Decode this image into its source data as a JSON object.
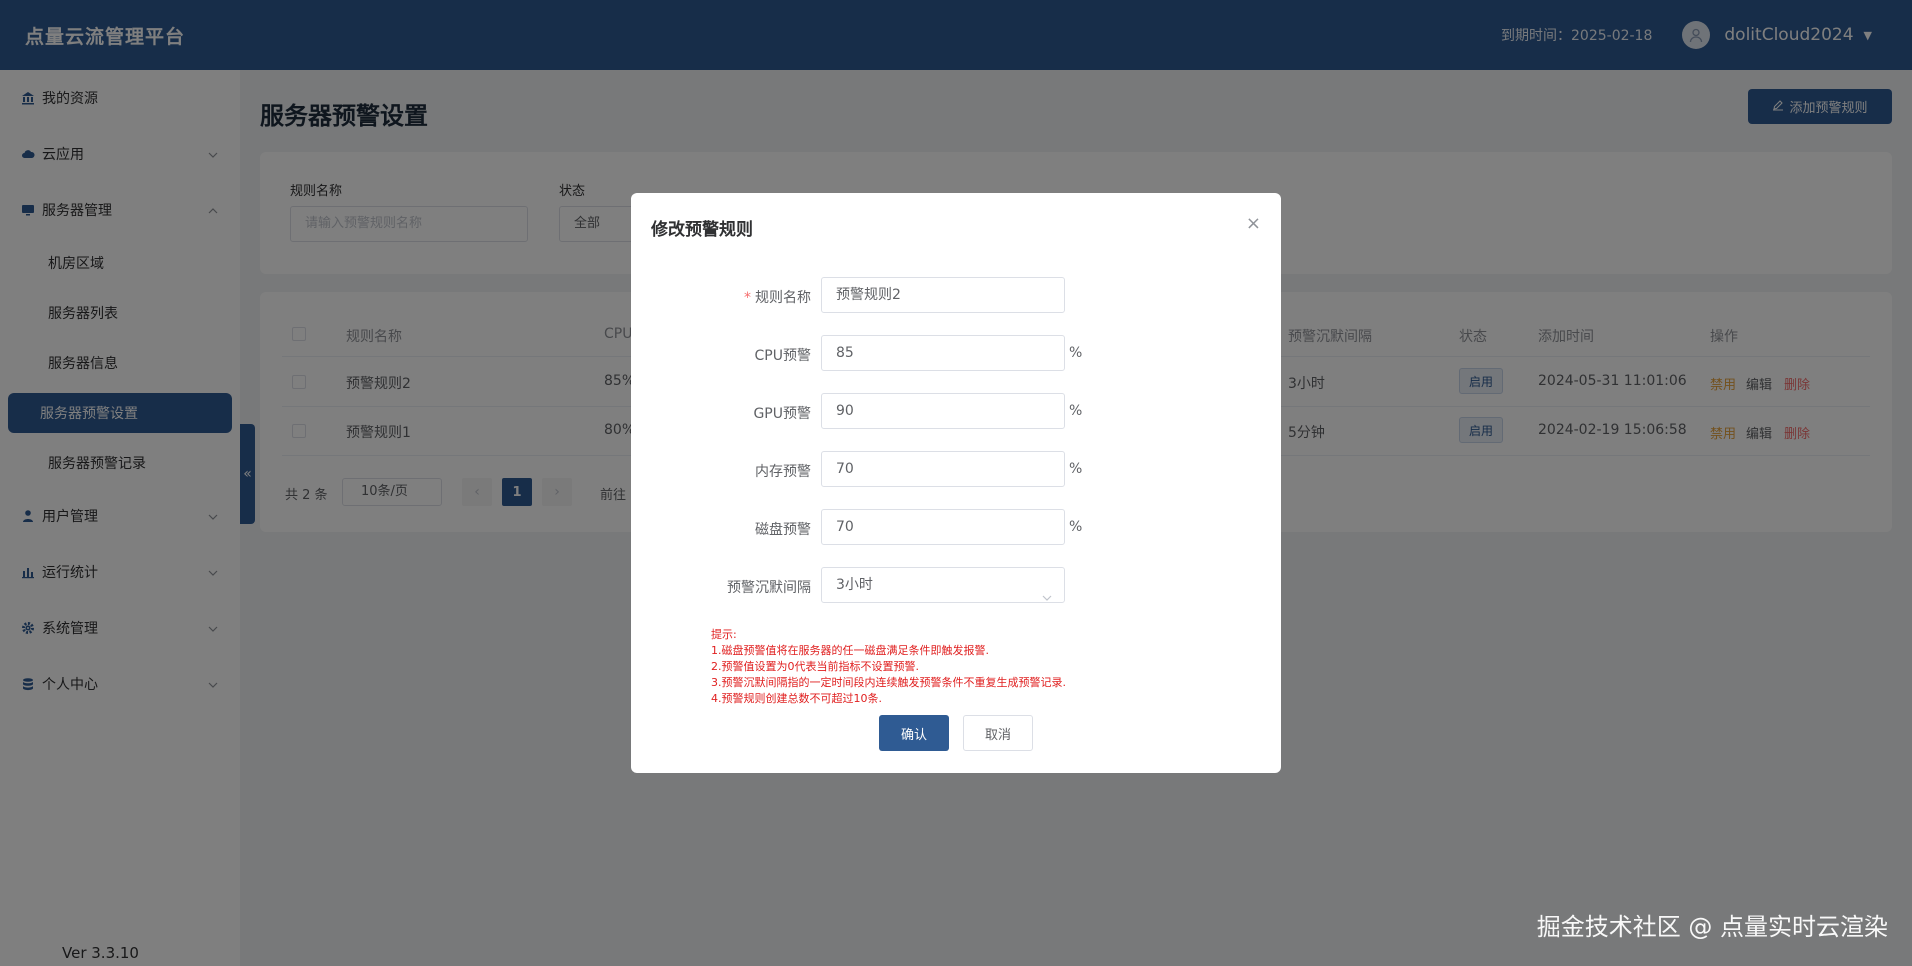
{
  "app": {
    "brand": "点量云流管理平台",
    "expire_text": "到期时间：2025-02-18",
    "username": "dolitCloud2024",
    "version": "Ver 3.3.10"
  },
  "sidebar": {
    "items": [
      {
        "label": "我的资源",
        "icon": "bank-icon"
      },
      {
        "label": "云应用",
        "icon": "cloud-icon"
      },
      {
        "label": "服务器管理",
        "icon": "monitor-icon"
      },
      {
        "label": "用户管理",
        "icon": "user-icon"
      },
      {
        "label": "运行统计",
        "icon": "bar-chart-icon"
      },
      {
        "label": "系统管理",
        "icon": "gear-icon"
      },
      {
        "label": "个人中心",
        "icon": "database-icon"
      }
    ],
    "sub_items": [
      "机房区域",
      "服务器列表",
      "服务器信息",
      "服务器预警设置",
      "服务器预警记录"
    ],
    "active_sub": "服务器预警设置",
    "collapse_glyph": "«"
  },
  "page": {
    "title": "服务器预警设置",
    "add_button": "添加预警规则"
  },
  "filter": {
    "rule_name_label": "规则名称",
    "rule_name_placeholder": "请输入预警规则名称",
    "status_label": "状态",
    "status_value": "全部"
  },
  "table": {
    "headers": {
      "name": "规则名称",
      "cpu": "CPU",
      "silence": "预警沉默间隔",
      "status": "状态",
      "added": "添加时间",
      "ops": "操作"
    },
    "rows": [
      {
        "name": "预警规则2",
        "cpu": "85%",
        "silence": "3小时",
        "status": "启用",
        "added": "2024-05-31 11:01:06"
      },
      {
        "name": "预警规则1",
        "cpu": "80%",
        "silence": "5分钟",
        "status": "启用",
        "added": "2024-02-19 15:06:58"
      }
    ],
    "actions": {
      "disable": "禁用",
      "edit": "编辑",
      "delete": "删除"
    }
  },
  "pagination": {
    "total": "共 2 条",
    "page_size": "10条/页",
    "current": "1",
    "goto": "前往"
  },
  "dialog": {
    "title": "修改预警规则",
    "fields": {
      "name": {
        "label": "规则名称",
        "value": "预警规则2"
      },
      "cpu": {
        "label": "CPU预警",
        "value": "85",
        "unit": "%"
      },
      "gpu": {
        "label": "GPU预警",
        "value": "90",
        "unit": "%"
      },
      "mem": {
        "label": "内存预警",
        "value": "70",
        "unit": "%"
      },
      "disk": {
        "label": "磁盘预警",
        "value": "70",
        "unit": "%"
      },
      "silence": {
        "label": "预警沉默间隔",
        "value": "3小时"
      }
    },
    "tips": [
      "提示:",
      "1.磁盘预警值将在服务器的任一磁盘满足条件即触发报警.",
      "2.预警值设置为0代表当前指标不设置预警.",
      "3.预警沉默间隔指的一定时间段内连续触发预警条件不重复生成预警记录.",
      "4.预警规则创建总数不可超过10条."
    ],
    "confirm": "确认",
    "cancel": "取消"
  },
  "watermark": "掘金技术社区 @ 点量实时云渲染",
  "colors": {
    "primary": "#2f5b93",
    "danger": "#f56c6c",
    "warning": "#e6a23c",
    "tip": "#e02020"
  }
}
